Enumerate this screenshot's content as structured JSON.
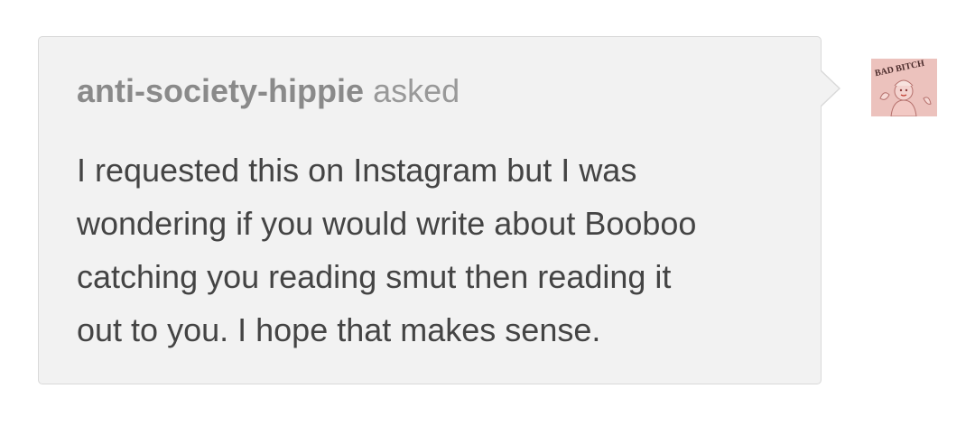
{
  "ask": {
    "asker": "anti-society-hippie",
    "verb": "asked",
    "question_lines": [
      "I requested this on Instagram but I was",
      "wondering if you would write about Booboo",
      "catching you reading smut then reading it",
      "out to you. I hope that makes sense."
    ]
  },
  "avatar": {
    "logo_text": "BAD BITCH"
  },
  "colors": {
    "bubble_bg": "#f2f2f2",
    "bubble_border": "#d9d9d9",
    "header_text": "#8f8f8f",
    "body_text": "#444444",
    "avatar_bg": "#e9b8b4"
  }
}
